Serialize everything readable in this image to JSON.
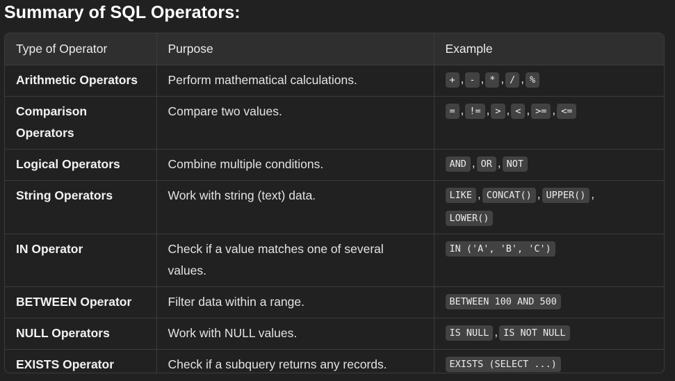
{
  "heading": "Summary of SQL Operators:",
  "columns": {
    "type": "Type of Operator",
    "purpose": "Purpose",
    "example": "Example"
  },
  "rows": [
    {
      "type": "Arithmetic Operators",
      "purpose": "Perform mathematical calculations.",
      "examples": [
        "+",
        "-",
        "*",
        "/",
        "%"
      ]
    },
    {
      "type_lines": [
        "Comparison",
        "Operators"
      ],
      "purpose": "Compare two values.",
      "examples": [
        "=",
        "!=",
        ">",
        "<",
        ">=",
        "<="
      ]
    },
    {
      "type": "Logical Operators",
      "purpose": "Combine multiple conditions.",
      "examples": [
        "AND",
        "OR",
        "NOT"
      ]
    },
    {
      "type": "String Operators",
      "purpose": "Work with string (text) data.",
      "examples": [
        "LIKE",
        "CONCAT()",
        "UPPER()",
        "LOWER()"
      ]
    },
    {
      "type": "IN Operator",
      "purpose_lines": [
        "Check if a value matches one of several",
        "values."
      ],
      "examples": [
        "IN ('A', 'B', 'C')"
      ]
    },
    {
      "type": "BETWEEN Operator",
      "purpose": "Filter data within a range.",
      "examples": [
        "BETWEEN 100 AND 500"
      ]
    },
    {
      "type": "NULL Operators",
      "purpose": "Work with NULL values.",
      "examples": [
        "IS NULL",
        "IS NOT NULL"
      ]
    },
    {
      "type": "EXISTS Operator",
      "purpose": "Check if a subquery returns any records.",
      "examples": [
        "EXISTS (SELECT ...)"
      ]
    }
  ],
  "separator": ","
}
